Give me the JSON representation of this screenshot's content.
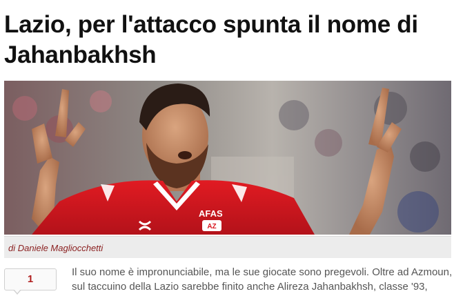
{
  "article": {
    "headline_line1": "Lazio, per l'attacco spunta il nome di",
    "headline_line2": "Jahanbakhsh",
    "photo": {
      "jersey_sponsor": "AFAS",
      "badge_text": "AZ"
    },
    "byline": "di Daniele Magliocchetti",
    "share_count": "1",
    "body_line1": "Il suo nome è impronunciabile, ma le sue giocate sono pregevoli. Oltre ad Azmoun,",
    "body_line2": "sul taccuino della Lazio sarebbe finito anche Alireza Jahanbakhsh, classe '93,"
  },
  "colors": {
    "byline": "#8a1f1f",
    "share_count": "#b01e1e",
    "jersey": "#d8161e",
    "caption_bar": "#ececec"
  }
}
